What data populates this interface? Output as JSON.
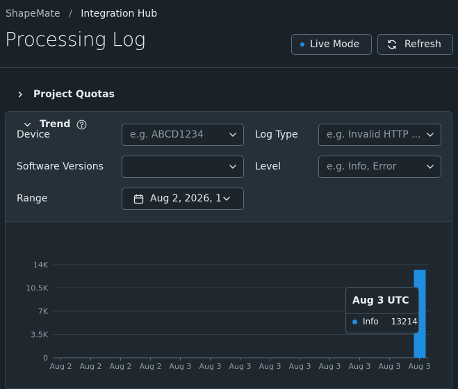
{
  "breadcrumb": {
    "home": "ShapeMate",
    "separator": "/",
    "current": "Integration Hub"
  },
  "page_title": "Processing Log",
  "header_buttons": {
    "live_mode": "Live Mode",
    "refresh": "Refresh"
  },
  "quotas": {
    "label": "Project Quotas"
  },
  "filters": {
    "device": {
      "label": "Device",
      "placeholder": "e.g. ABCD1234"
    },
    "log_type": {
      "label": "Log Type",
      "placeholder": "e.g. Invalid HTTP ..."
    },
    "software_versions": {
      "label": "Software Versions",
      "value": ""
    },
    "level": {
      "label": "Level",
      "placeholder": "e.g. Info, Error"
    },
    "range": {
      "label": "Range",
      "value": "Aug 2, 2026, 1"
    }
  },
  "trend": {
    "label": "Trend"
  },
  "colors": {
    "accent": "#1f8de0",
    "background": "#1a2229",
    "panel": "#253038"
  },
  "icons": [
    "chevron-right-icon",
    "chevron-down-icon",
    "refresh-icon",
    "calendar-icon",
    "help-icon"
  ],
  "chart_data": {
    "type": "bar",
    "title": "",
    "xlabel": "",
    "ylabel": "",
    "y_ticks": [
      "0",
      "3.5K",
      "7K",
      "10.5K",
      "14K"
    ],
    "ylim": [
      0,
      14000
    ],
    "categories": [
      "Aug 2",
      "Aug 2",
      "Aug 2",
      "Aug 2",
      "Aug 3",
      "Aug 3",
      "Aug 3",
      "Aug 3",
      "Aug 3",
      "Aug 3",
      "Aug 3",
      "Aug 3",
      "Aug 3"
    ],
    "series": [
      {
        "name": "Info",
        "values": [
          0,
          0,
          0,
          0,
          0,
          0,
          0,
          0,
          0,
          0,
          0,
          0,
          13214
        ]
      }
    ],
    "grid": true,
    "tooltip": {
      "title": "Aug 3 UTC",
      "series": "Info",
      "value": "13214"
    }
  }
}
